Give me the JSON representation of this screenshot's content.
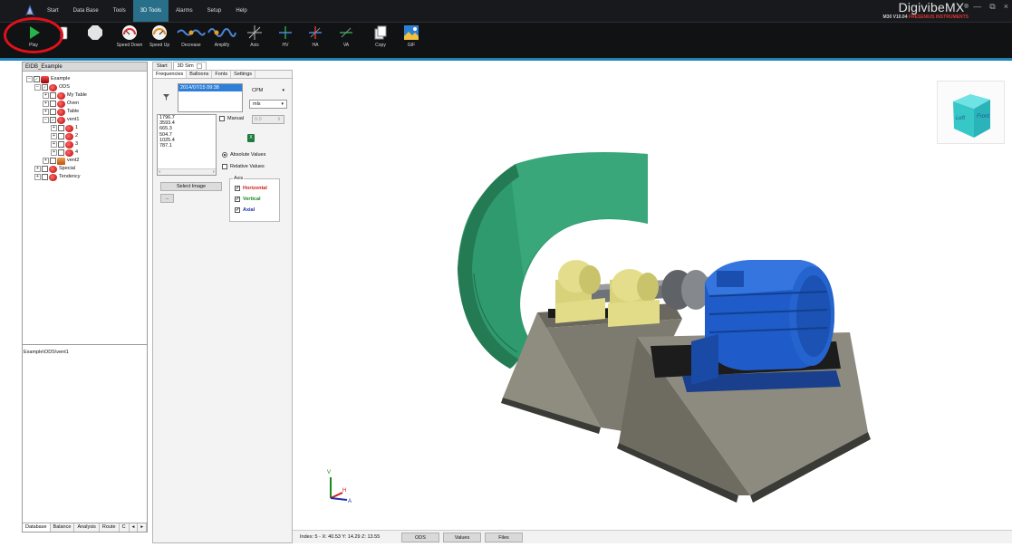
{
  "menu": {
    "items": [
      "Start",
      "Data Base",
      "Tools",
      "3D Tools",
      "Alarms",
      "Setup",
      "Help"
    ],
    "active_index": 3
  },
  "brand": {
    "name": "DigivibeMX",
    "version": "M30 V10.04",
    "company": "FRESENIUS INSTRUMENTS",
    "trademark": "®"
  },
  "window_controls": {
    "minimize": "—",
    "restore": "⧉",
    "close": "×"
  },
  "toolbar": {
    "play": "Play",
    "speed_down": "Speed Down",
    "speed_up": "Speed Up",
    "decrease": "Decrease",
    "amplify": "Amplify",
    "axis": "Axis",
    "hv": "HV",
    "ha": "HA",
    "va": "VA",
    "copy": "Copy",
    "gif": "GIF"
  },
  "left_panel": {
    "header": "EIDB_Example",
    "tree": [
      {
        "label": "Example",
        "level": 0,
        "expander": "−",
        "checked": true,
        "icon": "db"
      },
      {
        "label": "ODS",
        "level": 1,
        "expander": "−",
        "checked": true,
        "icon": "node"
      },
      {
        "label": "My Table",
        "level": 2,
        "expander": "+",
        "checked": false,
        "icon": "node"
      },
      {
        "label": "Oven",
        "level": 2,
        "expander": "+",
        "checked": false,
        "icon": "node"
      },
      {
        "label": "Table",
        "level": 2,
        "expander": "+",
        "checked": false,
        "icon": "node"
      },
      {
        "label": "vent1",
        "level": 2,
        "expander": "−",
        "checked": true,
        "icon": "node"
      },
      {
        "label": "1",
        "level": 3,
        "expander": "+",
        "checked": false,
        "icon": "node"
      },
      {
        "label": "2",
        "level": 3,
        "expander": "+",
        "checked": false,
        "icon": "node"
      },
      {
        "label": "3",
        "level": 3,
        "expander": "+",
        "checked": false,
        "icon": "node"
      },
      {
        "label": "4",
        "level": 3,
        "expander": "+",
        "checked": false,
        "icon": "node"
      },
      {
        "label": "vent2",
        "level": 2,
        "expander": "+",
        "checked": false,
        "icon": "folder"
      },
      {
        "label": "Special",
        "level": 1,
        "expander": "+",
        "checked": false,
        "icon": "node"
      },
      {
        "label": "Tendency",
        "level": 1,
        "expander": "+",
        "checked": false,
        "icon": "node"
      }
    ],
    "path": "Example\\ODS\\vent1",
    "bottom_tabs": [
      "Database",
      "Balance",
      "Analysis",
      "Route",
      "C",
      "◂",
      "▸"
    ]
  },
  "doc_tabs": [
    "Start",
    "3D Sim"
  ],
  "settings": {
    "tabs": [
      "Frequencies",
      "Balloons",
      "Fonts",
      "Settings"
    ],
    "date": "2014/07/15 09:38",
    "unit1": "CPM",
    "unit2": "mls",
    "frequencies": [
      "1796.7",
      "3593.4",
      "665.3",
      "504.7",
      "1025.4",
      "787.1"
    ],
    "manual_label": "Manual",
    "manual_value": "0.0",
    "excel_label": "X",
    "absolute": "Absolute Values",
    "relative": "Relative Values",
    "select_image": "Select Image",
    "small_button": "...",
    "axis_title": "Axis",
    "axis_items": [
      {
        "label": "Horizontal",
        "color": "#d11a1a"
      },
      {
        "label": "Vertical",
        "color": "#178a17"
      },
      {
        "label": "Axial",
        "color": "#1c2fa8"
      }
    ],
    "check_mark": "✓"
  },
  "axis_gizmo": {
    "v": "V",
    "h": "H",
    "a": "A"
  },
  "viewcube": {
    "left_face": "Left",
    "front_face": "Front"
  },
  "status": {
    "text": "Index: 5 - X: 40.53 Y: 14.29 Z: 13.55",
    "buttons": [
      "ODS",
      "Values",
      "Files"
    ]
  },
  "colors": {
    "accent": "#1f83b6",
    "fan_housing": "#2e8f66",
    "motor": "#1f5cc9",
    "bearing": "#ded87a",
    "base": "#8c8a7e",
    "highlight_circle": "#e0111b"
  }
}
